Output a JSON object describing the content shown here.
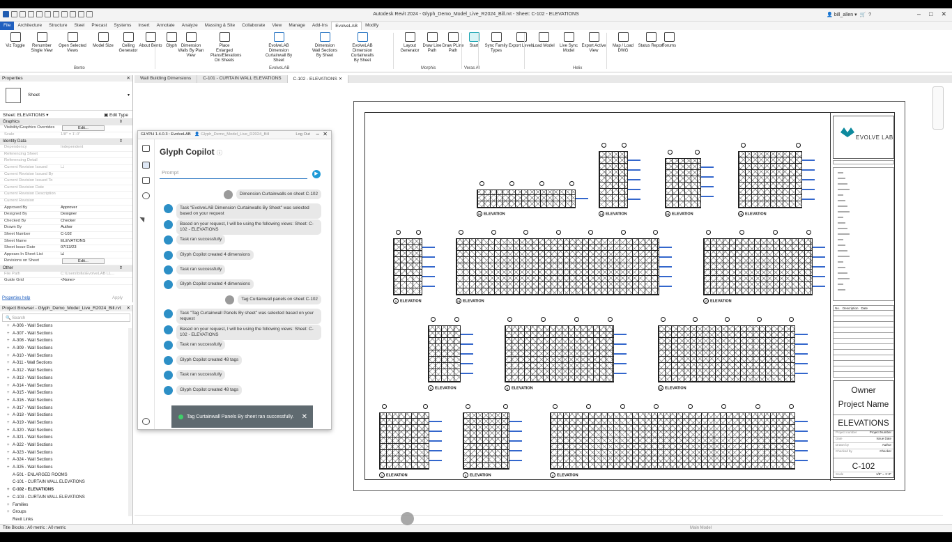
{
  "app": {
    "title": "Autodesk Revit 2024 - Glyph_Demo_Model_Live_R2024_Bill.rvt - Sheet: C-102 - ELEVATIONS",
    "user": "bill_allen"
  },
  "ribbon_tabs": [
    "File",
    "Architecture",
    "Structure",
    "Steel",
    "Precast",
    "Systems",
    "Insert",
    "Annotate",
    "Analyze",
    "Massing & Site",
    "Collaborate",
    "View",
    "Manage",
    "Add-Ins",
    "EvolveLAB",
    "Modify"
  ],
  "active_tab": "EvolveLAB",
  "ribbon": {
    "buttons": [
      {
        "label": "Viz Toggle",
        "icon": "viz-toggle-icon"
      },
      {
        "label": "Renumber Single View",
        "icon": "renumber-icon"
      },
      {
        "label": "Open Selected Views",
        "icon": "open-views-icon"
      },
      {
        "label": "Model Size",
        "icon": "model-size-icon"
      },
      {
        "label": "Ceiling Generator",
        "icon": "ceiling-icon"
      },
      {
        "label": "About Bento",
        "icon": "about-bento-icon"
      },
      {
        "label": "Glyph",
        "icon": "glyph-icon"
      },
      {
        "label": "Dimension Walls By Plan View",
        "icon": "dim-walls-icon"
      },
      {
        "label": "Place Enlarged Plans/Elevations On Sheets",
        "icon": "place-enlarged-icon"
      },
      {
        "label": "EvolveLAB Dimension Curtainwall By Sheet",
        "icon": "dim-cw-icon"
      },
      {
        "label": "Dimension Wall Sections By Sheet",
        "icon": "dim-wall-sections-icon"
      },
      {
        "label": "EvolveLAB Dimension Curtainwalls By Sheet",
        "icon": "dim-cws-icon"
      },
      {
        "label": "Layout Generator",
        "icon": "layout-gen-icon"
      },
      {
        "label": "Draw Line Path",
        "icon": "draw-line-icon"
      },
      {
        "label": "Draw PLine Path",
        "icon": "draw-pline-icon"
      },
      {
        "label": "Start",
        "icon": "start-icon"
      },
      {
        "label": "Sync Family Types",
        "icon": "sync-icon"
      },
      {
        "label": "Export Levels",
        "icon": "export-levels-icon"
      },
      {
        "label": "Load Model",
        "icon": "load-model-icon"
      },
      {
        "label": "Live Sync Model",
        "icon": "live-sync-icon"
      },
      {
        "label": "Export Active View",
        "icon": "export-view-icon"
      },
      {
        "label": "Map / Load DWG",
        "icon": "dwg-icon"
      },
      {
        "label": "Status Report",
        "icon": "status-icon"
      },
      {
        "label": "Forums",
        "icon": "forums-icon"
      }
    ],
    "groups": [
      "Bento",
      "EvolveLAB",
      "Morphis",
      "Veras AI",
      "Helix"
    ]
  },
  "properties": {
    "header": "Properties",
    "type": "Sheet",
    "selector": "Sheet: ELEVATIONS",
    "edit_type": "Edit Type",
    "cat_graphics": "Graphics",
    "cat_identity": "Identity Data",
    "cat_other": "Other",
    "rows_graphics": [
      {
        "k": "Visibility/Graphics Overrides",
        "v": "Edit...",
        "btn": true,
        "dim": false
      },
      {
        "k": "Scale",
        "v": "1/8\" = 1'-0\"",
        "btn": false,
        "dim": true
      }
    ],
    "rows_identity": [
      {
        "k": "Dependency",
        "v": "Independent",
        "dim": true
      },
      {
        "k": "Referencing Sheet",
        "v": "",
        "dim": true
      },
      {
        "k": "Referencing Detail",
        "v": "",
        "dim": true
      },
      {
        "k": "Current Revision Issued",
        "v": "☐",
        "dim": true
      },
      {
        "k": "Current Revision Issued By",
        "v": "",
        "dim": true
      },
      {
        "k": "Current Revision Issued To",
        "v": "",
        "dim": true
      },
      {
        "k": "Current Revision Date",
        "v": "",
        "dim": true
      },
      {
        "k": "Current Revision Description",
        "v": "",
        "dim": true
      },
      {
        "k": "Current Revision",
        "v": "",
        "dim": true
      },
      {
        "k": "Approved By",
        "v": "Approver",
        "dim": false
      },
      {
        "k": "Designed By",
        "v": "Designer",
        "dim": false
      },
      {
        "k": "Checked By",
        "v": "Checker",
        "dim": false
      },
      {
        "k": "Drawn By",
        "v": "Author",
        "dim": false
      },
      {
        "k": "Sheet Number",
        "v": "C-102",
        "dim": false
      },
      {
        "k": "Sheet Name",
        "v": "ELEVATIONS",
        "dim": false
      },
      {
        "k": "Sheet Issue Date",
        "v": "07/13/23",
        "dim": false
      },
      {
        "k": "Appears In Sheet List",
        "v": "☑",
        "dim": false
      },
      {
        "k": "Revisions on Sheet",
        "v": "Edit...",
        "btn": true,
        "dim": false
      }
    ],
    "rows_other": [
      {
        "k": "File Path",
        "v": "C:\\Users\\billa\\EvolveLAB LL...",
        "dim": true
      },
      {
        "k": "Guide Grid",
        "v": "<None>",
        "dim": false
      }
    ],
    "help": "Properties help",
    "apply": "Apply"
  },
  "browser": {
    "header": "Project Browser - Glyph_Demo_Model_Live_R2024_Bill.rvt",
    "search_placeholder": "Search",
    "items": [
      {
        "pm": "+",
        "label": "A-306 - Wall Sections"
      },
      {
        "pm": "+",
        "label": "A-307 - Wall Sections"
      },
      {
        "pm": "+",
        "label": "A-308 - Wall Sections"
      },
      {
        "pm": "+",
        "label": "A-309 - Wall Sections"
      },
      {
        "pm": "+",
        "label": "A-310 - Wall Sections"
      },
      {
        "pm": "+",
        "label": "A-311 - Wall Sections"
      },
      {
        "pm": "+",
        "label": "A-312 - Wall Sections"
      },
      {
        "pm": "+",
        "label": "A-313 - Wall Sections"
      },
      {
        "pm": "+",
        "label": "A-314 - Wall Sections"
      },
      {
        "pm": "+",
        "label": "A-315 - Wall Sections"
      },
      {
        "pm": "+",
        "label": "A-316 - Wall Sections"
      },
      {
        "pm": "+",
        "label": "A-317 - Wall Sections"
      },
      {
        "pm": "+",
        "label": "A-318 - Wall Sections"
      },
      {
        "pm": "+",
        "label": "A-319 - Wall Sections"
      },
      {
        "pm": "+",
        "label": "A-320 - Wall Sections"
      },
      {
        "pm": "+",
        "label": "A-321 - Wall Sections"
      },
      {
        "pm": "+",
        "label": "A-322 - Wall Sections"
      },
      {
        "pm": "+",
        "label": "A-323 - Wall Sections"
      },
      {
        "pm": "+",
        "label": "A-324 - Wall Sections"
      },
      {
        "pm": "+",
        "label": "A-325 - Wall Sections"
      },
      {
        "pm": "",
        "label": "A-501 - ENLARGED ROOMS"
      },
      {
        "pm": "",
        "label": "C-101 - CURTAIN WALL ELEVATIONS"
      },
      {
        "pm": "+",
        "label": "C-102 - ELEVATIONS",
        "sel": true
      },
      {
        "pm": "+",
        "label": "C-103 - CURTAIN WALL ELEVATIONS"
      },
      {
        "pm": "+",
        "label": "Families"
      },
      {
        "pm": "+",
        "label": "Groups"
      },
      {
        "pm": "",
        "label": "Revit Links"
      }
    ]
  },
  "doc_tabs": [
    "Wall Building Dimensions",
    "C-101 - CURTAIN WALL ELEVATIONS",
    "C-102 - ELEVATIONS"
  ],
  "glyph": {
    "header": "GLYPH 1.4.0.3 : EvolveLAB",
    "model": "Glyph_Demo_Model_Live_R2024_Bill",
    "logout": "Log Out",
    "title": "Glyph Copilot",
    "prompt_placeholder": "Prompt",
    "messages": [
      {
        "user": true,
        "text": "Dimension  Curtainwalls on sheet C-102"
      },
      {
        "user": false,
        "text": "Task \"EvolveLAB Dimension Curtainwalls By Sheet\" was selected based on your request"
      },
      {
        "user": false,
        "text": "Based on your request, I will be using the following views: Sheet: C-102 - ELEVATIONS"
      },
      {
        "user": false,
        "text": "Task ran successfully"
      },
      {
        "user": false,
        "text": "Glyph Copilot created 4 dimensions"
      },
      {
        "user": false,
        "text": "Task ran successfully"
      },
      {
        "user": false,
        "text": "Glyph Copilot created 4 dimensions"
      },
      {
        "user": true,
        "text": "Tag Curtainwall panels on sheet C-102"
      },
      {
        "user": false,
        "text": "Task \"Tag Curtainwall Panels By sheet\" was selected based on your request"
      },
      {
        "user": false,
        "text": "Based on your request, I will be using the following views: Sheet: C-102 - ELEVATIONS"
      },
      {
        "user": false,
        "text": "Task ran successfully"
      },
      {
        "user": false,
        "text": "Glyph Copilot created 48 tags"
      },
      {
        "user": false,
        "text": "Task ran successfully"
      },
      {
        "user": false,
        "text": "Glyph Copilot created 48 tags"
      }
    ],
    "toast": "Tag Curtainwall Panels By sheet ran successfully."
  },
  "sheet": {
    "company": "EVOLVE LAB",
    "owner": "Owner",
    "project_name": "Project Name",
    "sheet_title": "ELEVATIONS",
    "sheet_number": "C-102",
    "rev_headers": [
      "No.",
      "Description",
      "Date"
    ],
    "info": [
      {
        "lab": "Project number",
        "val": "Project Number"
      },
      {
        "lab": "Date",
        "val": "Issue Date"
      },
      {
        "lab": "Drawn by",
        "val": "Author"
      },
      {
        "lab": "Checked by",
        "val": "Checker"
      }
    ],
    "scale": "1/8\" = 1'-0\"",
    "elevation_label": "ELEVATION",
    "elevations": [
      "1",
      "2",
      "3",
      "4",
      "5",
      "6",
      "10",
      "11",
      "12",
      "13",
      "14",
      "15",
      "16",
      "17"
    ]
  },
  "statusbar": {
    "left": "Title Blocks : A0 metric : A0 metric",
    "model": "Main Model"
  },
  "colors": {
    "accent": "#1f5fbf",
    "glyph_blue": "#2c8fc6",
    "toast_bg": "#5f6a70",
    "brand_teal": "#0e8a9e"
  }
}
